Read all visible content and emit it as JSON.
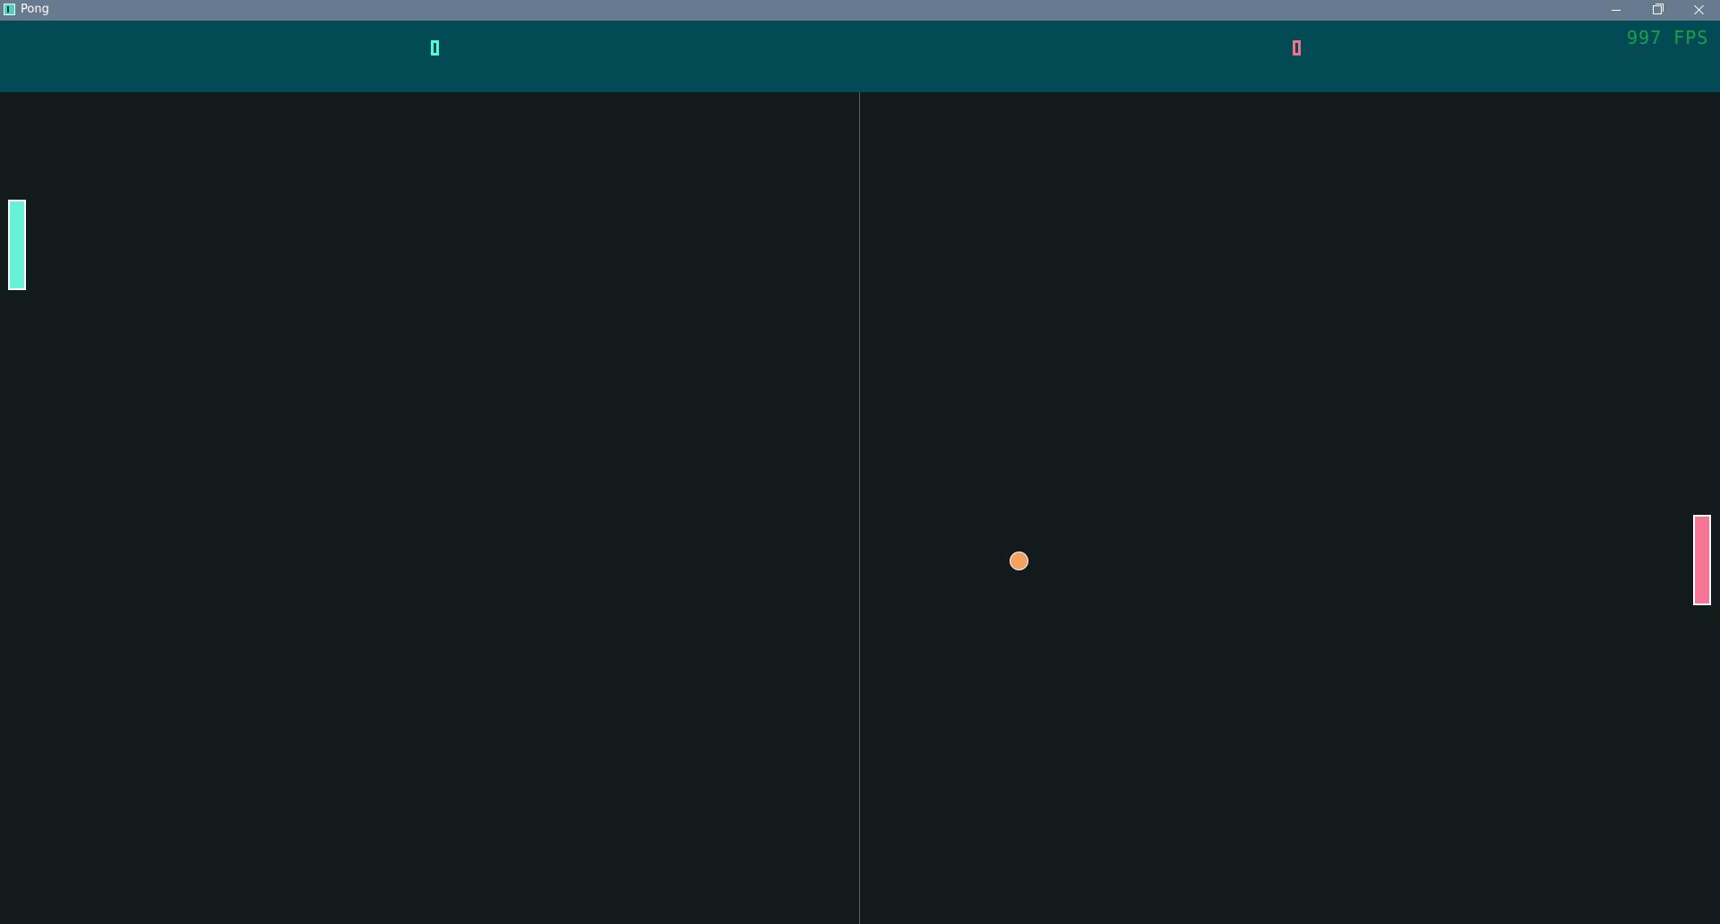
{
  "window": {
    "title": "Pong",
    "controls": [
      "minimize",
      "maximize",
      "close"
    ]
  },
  "scoreboard": {
    "left_score": "0",
    "right_score": "0",
    "fps": "997 FPS",
    "left_color": "#4dfcd8",
    "right_color": "#f36f8e",
    "fps_color": "#16a34a"
  },
  "game": {
    "left_paddle_color": "#66f2d9",
    "right_paddle_color": "#f47594",
    "ball_color": "#f4a261",
    "field_color": "#131a1c",
    "header_color": "#024b55"
  }
}
